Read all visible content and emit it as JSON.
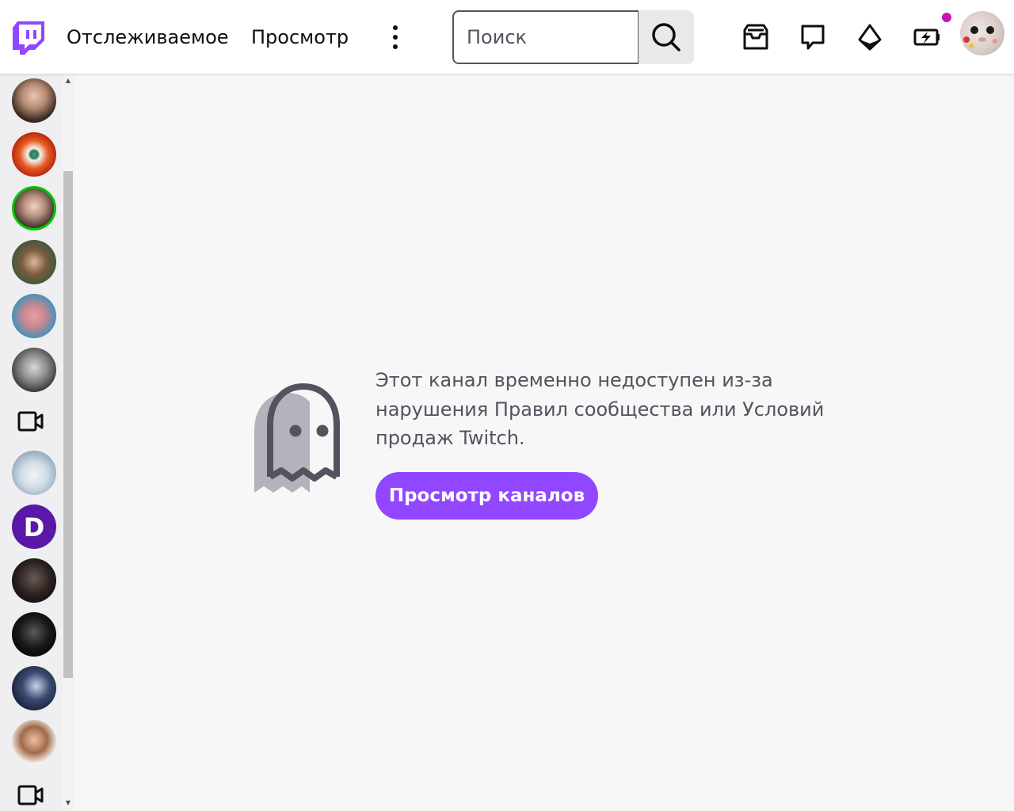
{
  "colors": {
    "brand": "#9147ff",
    "text_primary": "#0e0e10",
    "text_secondary": "#53535f",
    "notification": "#c514b9",
    "live_ring": "#00c800",
    "background": "#f7f7f8"
  },
  "header": {
    "logo_icon": "twitch-logo-icon",
    "following_label": "Отслеживаемое",
    "browse_label": "Просмотр",
    "more_icon": "more-vertical-icon",
    "search": {
      "placeholder": "Поиск",
      "value": "",
      "button_icon": "search-icon"
    },
    "icons": [
      "inbox-icon",
      "whispers-icon",
      "bits-icon",
      "prime-crown-icon"
    ],
    "avatar_icon": "user-avatar"
  },
  "sidebar": {
    "items": [
      {
        "type": "avatar",
        "name": "followed-channel-1"
      },
      {
        "type": "avatar",
        "name": "followed-channel-2"
      },
      {
        "type": "avatar",
        "name": "followed-channel-3",
        "live": true
      },
      {
        "type": "avatar",
        "name": "followed-channel-4"
      },
      {
        "type": "avatar",
        "name": "followed-channel-5"
      },
      {
        "type": "avatar",
        "name": "followed-channel-6"
      },
      {
        "type": "section-icon",
        "icon": "video-camera-icon"
      },
      {
        "type": "avatar",
        "name": "followed-channel-7"
      },
      {
        "type": "avatar",
        "name": "followed-channel-8"
      },
      {
        "type": "avatar",
        "name": "followed-channel-9"
      },
      {
        "type": "avatar",
        "name": "followed-channel-10"
      },
      {
        "type": "avatar",
        "name": "followed-channel-11"
      },
      {
        "type": "avatar",
        "name": "followed-channel-12"
      },
      {
        "type": "section-icon",
        "icon": "video-camera-icon"
      }
    ]
  },
  "main": {
    "illustration_icon": "ghost-icon",
    "message_line1": "Этот канал временно недоступен из-за",
    "message_line2": "нарушения Правил сообщества или Условий",
    "message_line3": "продаж Twitch.",
    "button_label": "Просмотр каналов"
  }
}
